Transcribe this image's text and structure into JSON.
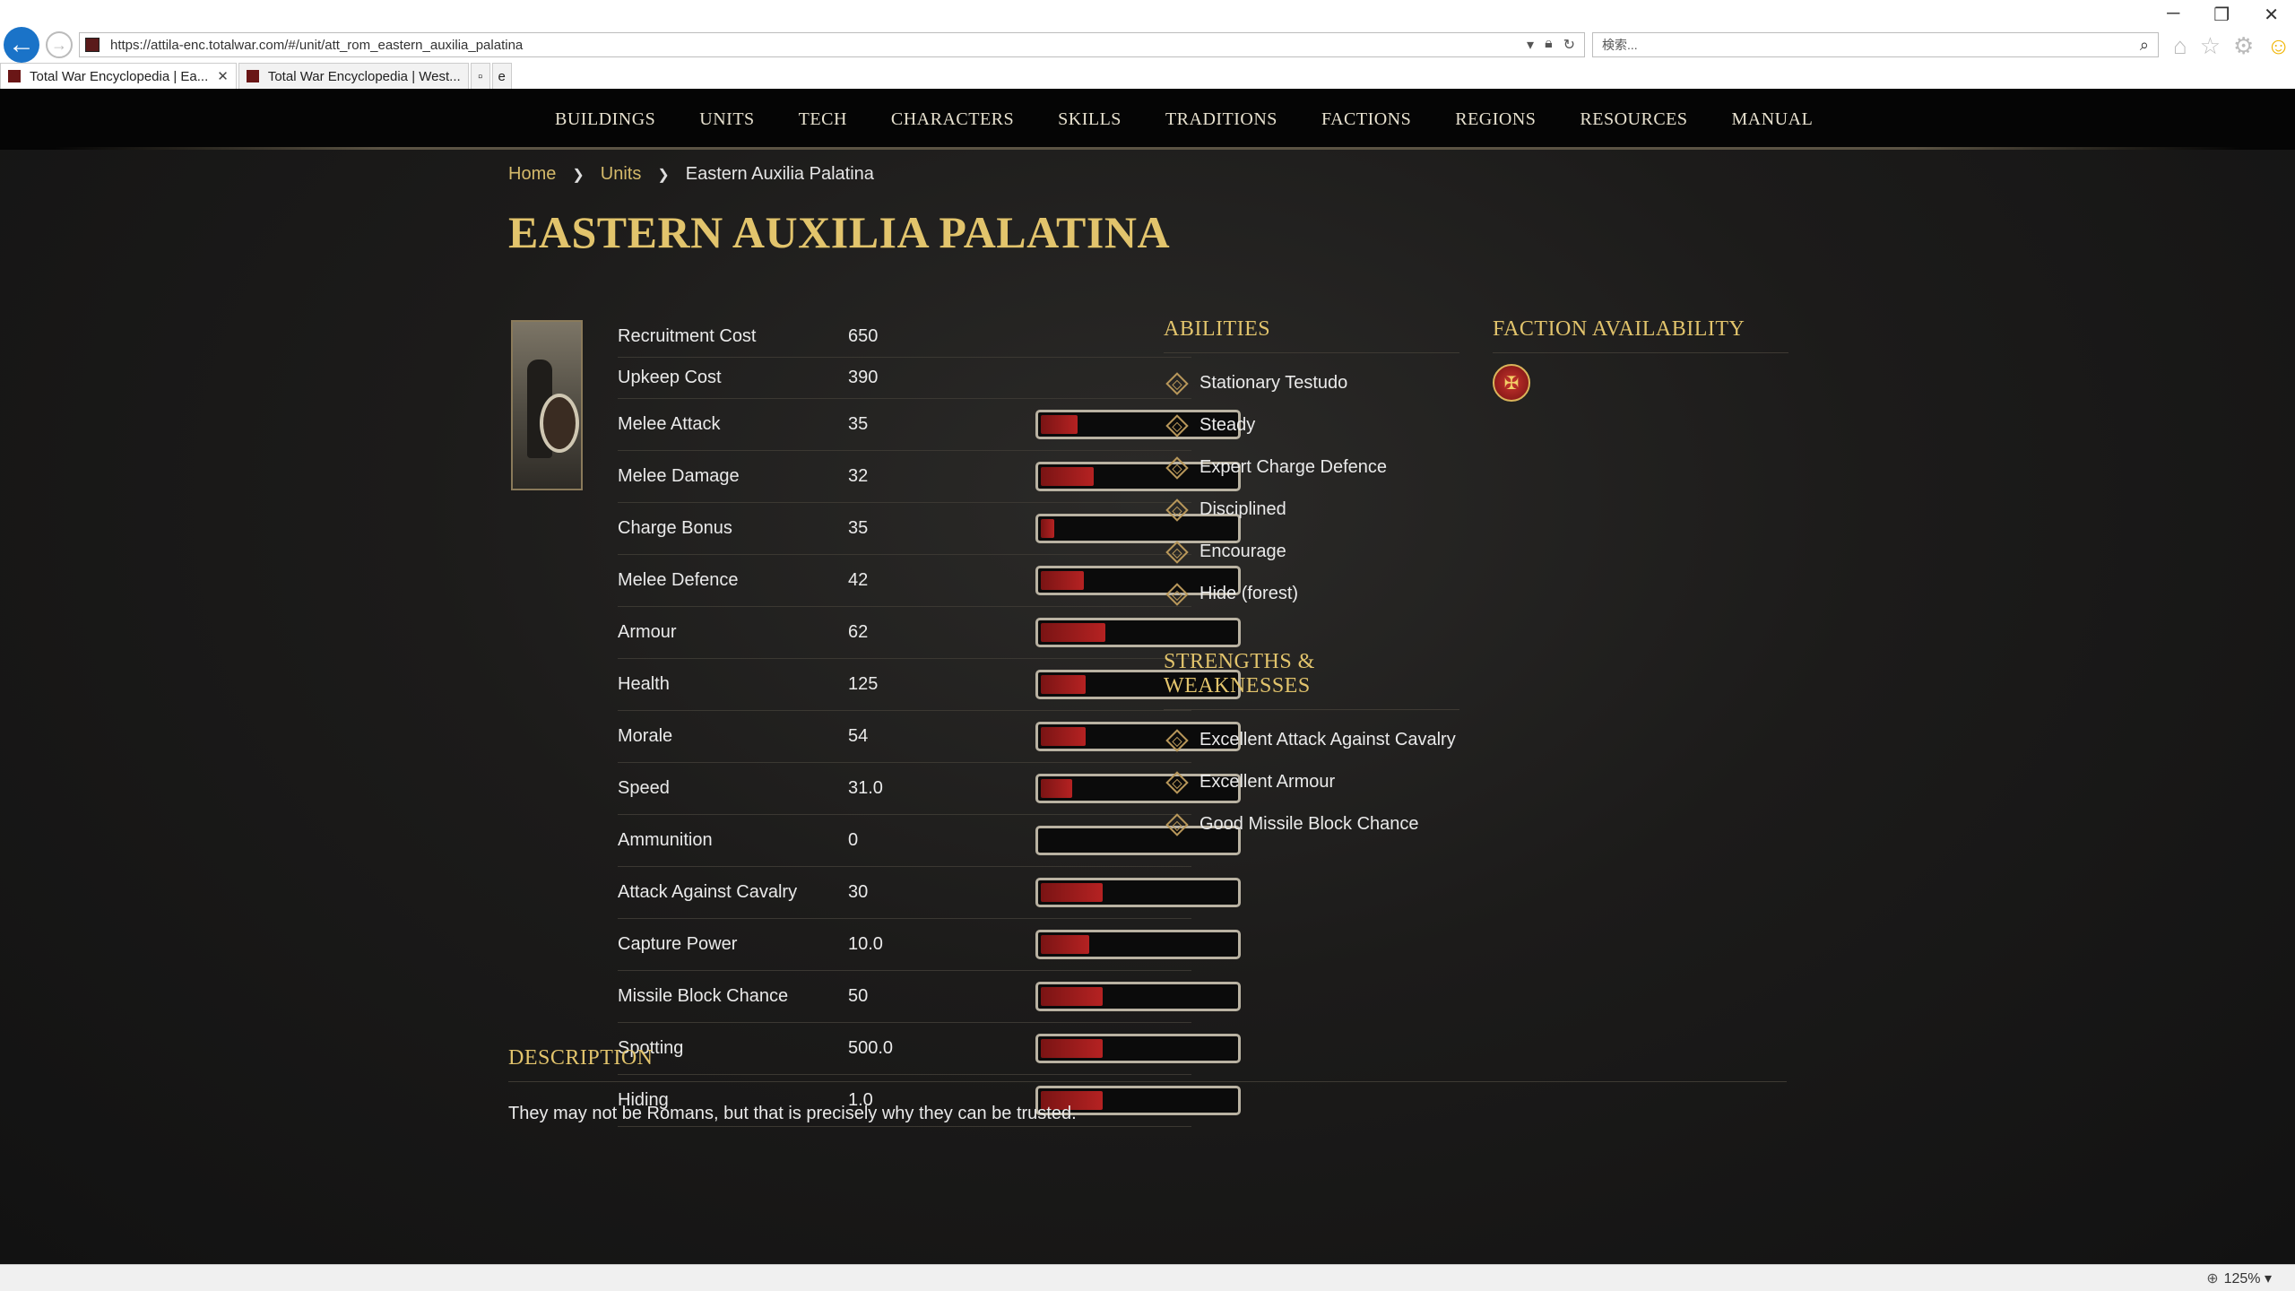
{
  "browser": {
    "url": "https://attila-enc.totalwar.com/#/unit/att_rom_eastern_auxilia_palatina",
    "search_placeholder": "検索...",
    "tabs": [
      {
        "label": "Total War Encyclopedia | Ea..."
      },
      {
        "label": "Total War Encyclopedia | West..."
      }
    ],
    "zoom": "125%"
  },
  "nav": [
    "BUILDINGS",
    "UNITS",
    "TECH",
    "CHARACTERS",
    "SKILLS",
    "TRADITIONS",
    "FACTIONS",
    "REGIONS",
    "RESOURCES",
    "MANUAL"
  ],
  "breadcrumb": {
    "home": "Home",
    "units": "Units",
    "current": "Eastern Auxilia Palatina"
  },
  "title": "EASTERN AUXILIA PALATINA",
  "stats": [
    {
      "name": "Recruitment Cost",
      "value": "650"
    },
    {
      "name": "Upkeep Cost",
      "value": "390"
    },
    {
      "name": "Melee Attack",
      "value": "35",
      "level": 0.19
    },
    {
      "name": "Melee Damage",
      "value": "32",
      "level": 0.27
    },
    {
      "name": "Charge Bonus",
      "value": "35",
      "level": 0.07
    },
    {
      "name": "Melee Defence",
      "value": "42",
      "level": 0.22
    },
    {
      "name": "Armour",
      "value": "62",
      "level": 0.33
    },
    {
      "name": "Health",
      "value": "125",
      "level": 0.23
    },
    {
      "name": "Morale",
      "value": "54",
      "level": 0.23
    },
    {
      "name": "Speed",
      "value": "31.0",
      "level": 0.16
    },
    {
      "name": "Ammunition",
      "value": "0",
      "level": 0
    },
    {
      "name": "Attack Against Cavalry",
      "value": "30",
      "level": 0.32
    },
    {
      "name": "Capture Power",
      "value": "10.0",
      "level": 0.25
    },
    {
      "name": "Missile Block Chance",
      "value": "50",
      "level": 0.32
    },
    {
      "name": "Spotting",
      "value": "500.0",
      "level": 0.32
    },
    {
      "name": "Hiding",
      "value": "1.0",
      "level": 0.32
    }
  ],
  "abilities": {
    "title": "ABILITIES",
    "items": [
      "Stationary Testudo",
      "Steady",
      "Expert Charge Defence",
      "Disciplined",
      "Encourage",
      "Hide (forest)"
    ]
  },
  "strengths": {
    "title": "STRENGTHS & WEAKNESSES",
    "items": [
      "Excellent Attack Against Cavalry",
      "Excellent Armour",
      "Good Missile Block Chance"
    ]
  },
  "faction": {
    "title": "FACTION AVAILABILITY"
  },
  "description": {
    "title": "DESCRIPTION",
    "text": "They may not be Romans, but that is precisely why they can be trusted."
  },
  "colors": {
    "accent_gold": "#e2c46c",
    "bar_red": "#b52222",
    "link_gold": "#d4b96a"
  }
}
